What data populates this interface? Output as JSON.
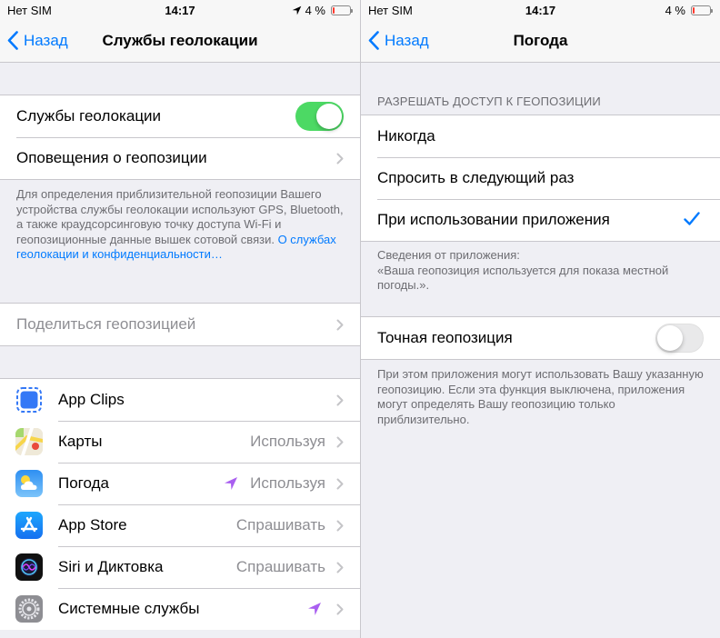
{
  "left": {
    "status": {
      "carrier": "Нет SIM",
      "time": "14:17",
      "battery": "4 %"
    },
    "nav": {
      "back_label": "Назад",
      "title": "Службы геолокации"
    },
    "location_services": {
      "label": "Службы геолокации",
      "enabled": true
    },
    "alerts": {
      "label": "Оповещения о геопозиции"
    },
    "description": {
      "text": "Для определения приблизительной геопозиции Вашего устройства службы геолокации используют GPS, Bluetooth, а также краудсорсинговую точку доступа Wi-Fi и геопозиционные данные вышек сотовой связи. ",
      "link": "О службах геолокации и конфиденциальности…"
    },
    "share_location": {
      "label": "Поделиться геопозицией"
    },
    "apps": [
      {
        "name": "App Clips",
        "value": "",
        "icon": "app-clips-icon"
      },
      {
        "name": "Карты",
        "value": "Используя",
        "icon": "maps-icon"
      },
      {
        "name": "Погода",
        "value": "Используя",
        "icon": "weather-icon",
        "location_active": true
      },
      {
        "name": "App Store",
        "value": "Спрашивать",
        "icon": "app-store-icon"
      },
      {
        "name": "Siri и Диктовка",
        "value": "Спрашивать",
        "icon": "siri-icon"
      },
      {
        "name": "Системные службы",
        "value": "",
        "icon": "settings-icon",
        "location_active": true
      }
    ]
  },
  "right": {
    "status": {
      "carrier": "Нет SIM",
      "time": "14:17",
      "battery": "4 %"
    },
    "nav": {
      "back_label": "Назад",
      "title": "Погода"
    },
    "access_header": "РАЗРЕШАТЬ ДОСТУП К ГЕОПОЗИЦИИ",
    "options": [
      {
        "label": "Никогда",
        "selected": false
      },
      {
        "label": "Спросить в следующий раз",
        "selected": false
      },
      {
        "label": "При использовании приложения",
        "selected": true
      }
    ],
    "app_info": "Сведения от приложения:\n«Ваша геопозиция используется для показа местной погоды.».",
    "precise": {
      "label": "Точная геопозиция",
      "enabled": false
    },
    "precise_footer": "При этом приложения могут использовать Вашу указанную геопозицию. Если эта функция выключена, приложения могут определять Вашу геопозицию только приблизительно."
  },
  "colors": {
    "accent": "#007aff",
    "toggle_on": "#4cd964",
    "location_arrow": "#a95ff0",
    "background": "#efeff4",
    "secondary_text": "#8e8e93"
  }
}
